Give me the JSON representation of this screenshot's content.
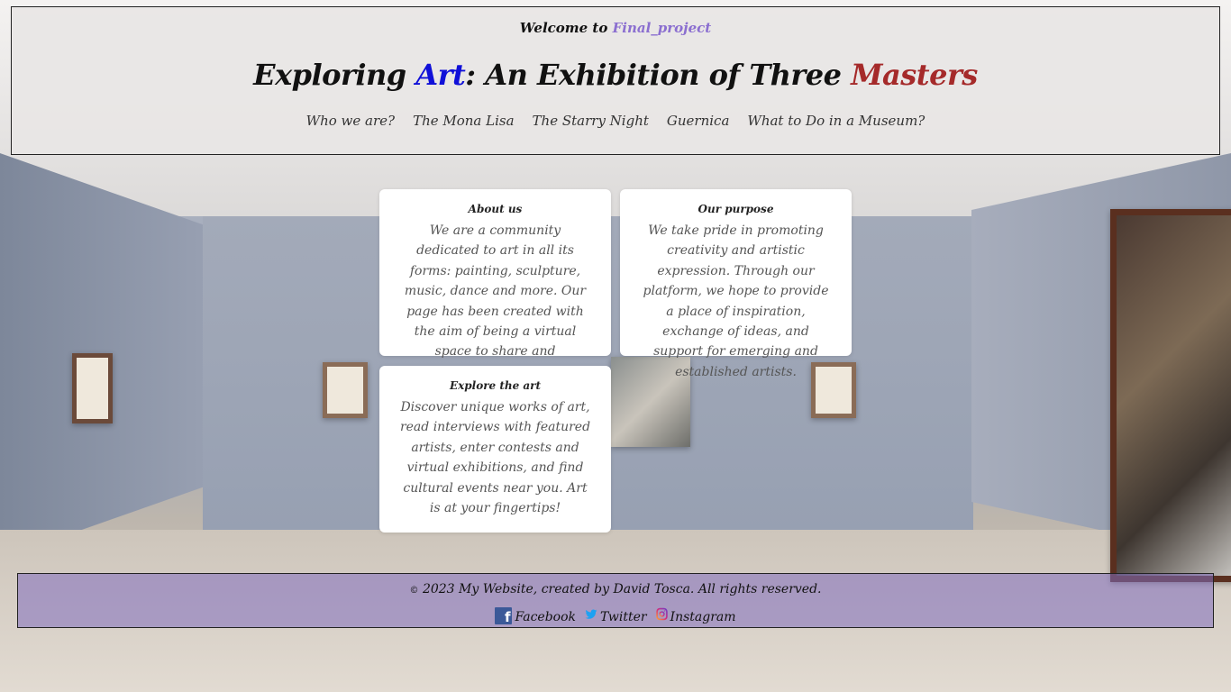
{
  "header": {
    "welcome_prefix": "Welcome to",
    "welcome_name": "Final_project",
    "title_part1": "Exploring ",
    "title_art": "Art",
    "title_part2": ": An Exhibition of Three ",
    "title_masters": "Masters"
  },
  "nav": {
    "items": [
      {
        "label": "Who we are?"
      },
      {
        "label": "The Mona Lisa"
      },
      {
        "label": "The Starry Night"
      },
      {
        "label": "Guernica"
      },
      {
        "label": "What to Do in a Museum?"
      }
    ]
  },
  "cards": [
    {
      "title": "About us",
      "text": "We are a community dedicated to art in all its forms: painting, sculpture, music, dance and more. Our page has been created with the aim of being a virtual space to share and appreciate art.."
    },
    {
      "title": "Our purpose",
      "text": "We take pride in promoting creativity and artistic expression. Through our platform, we hope to provide a place of inspiration, exchange of ideas, and support for emerging and established artists."
    },
    {
      "title": "Explore the art",
      "text": "Discover unique works of art, read interviews with featured artists, enter contests and virtual exhibitions, and find cultural events near you. Art is at your fingertips!"
    }
  ],
  "footer": {
    "copyright_symbol": "©",
    "copyright_text": "2023 My Website, created by David Tosca. All rights reserved.",
    "social": [
      {
        "label": "Facebook",
        "icon": "facebook-icon"
      },
      {
        "label": "Twitter",
        "icon": "twitter-icon"
      },
      {
        "label": "Instagram",
        "icon": "instagram-icon"
      }
    ]
  },
  "colors": {
    "accent_welcome": "#8b6fd0",
    "title_art": "#1010d8",
    "title_masters": "#a52a2a",
    "footer_bg": "#8a76c2"
  }
}
